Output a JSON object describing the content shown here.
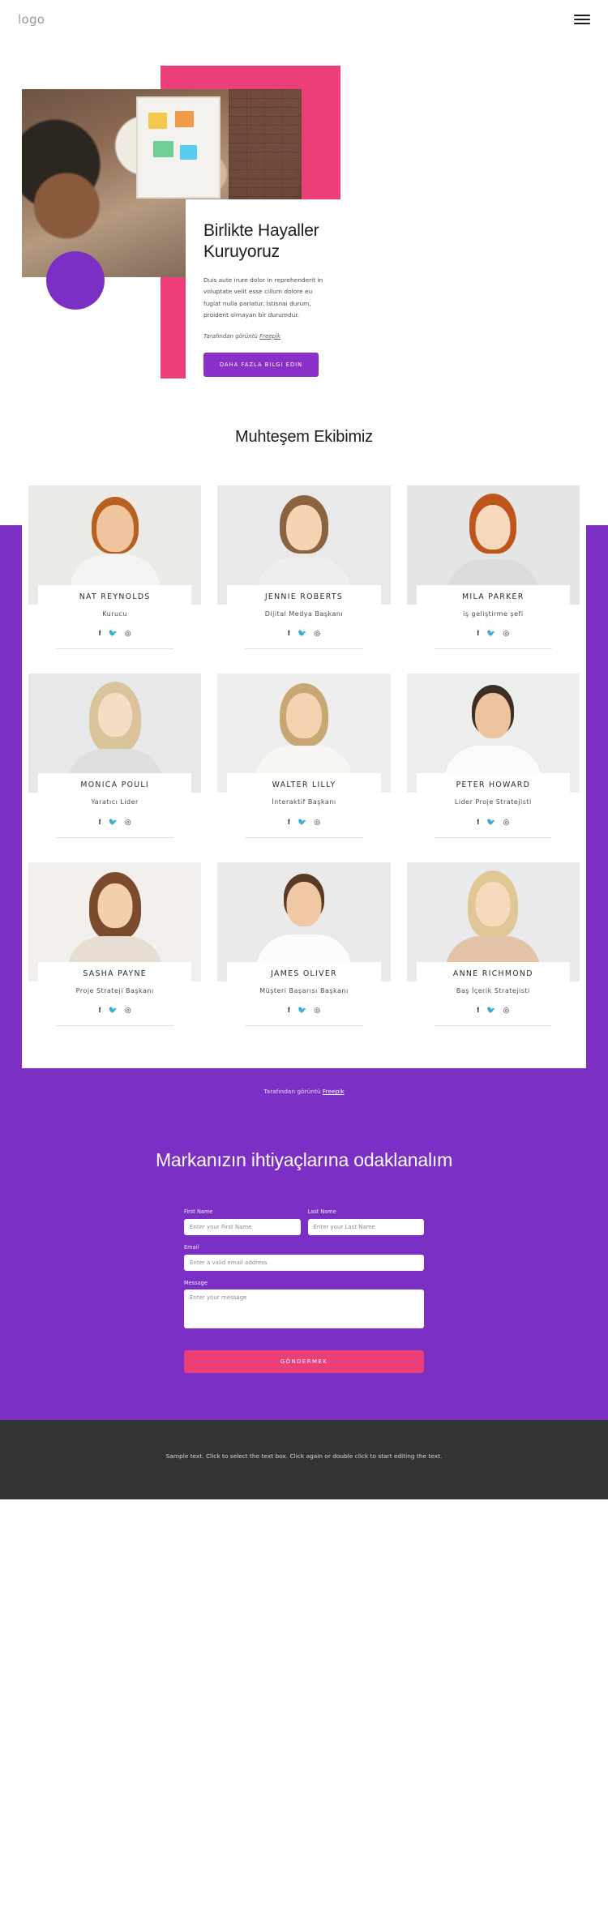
{
  "header": {
    "logo": "logo",
    "menu_icon": "hamburger-menu-icon"
  },
  "hero": {
    "heading": "Birlikte Hayaller Kuruyoruz",
    "body": "Duis aute irure dolor in reprehenderit in voluptate velit esse cillum dolore eu fugiat nulla pariatur. İstisnai durum, proident olmayan bir durumdur.",
    "credit_prefix": "Tarafından görüntü ",
    "credit_link": "Freepik",
    "button": "DAHA FAZLA BILGI EDIN",
    "accent_pink": "#ec3f78",
    "accent_purple": "#7b2fc4"
  },
  "team": {
    "title": "Muhteşem Ekibimiz",
    "credit_prefix": "Tarafından görüntü ",
    "credit_link": "Freepik",
    "social_icons": [
      "facebook-icon",
      "twitter-icon",
      "instagram-icon"
    ],
    "members": [
      {
        "name": "NAT REYNOLDS",
        "role": "Kurucu"
      },
      {
        "name": "JENNIE ROBERTS",
        "role": "Dijital Medya Başkanı"
      },
      {
        "name": "MILA PARKER",
        "role": "iş geliştirme şefi"
      },
      {
        "name": "MONICA POULI",
        "role": "Yaratıcı Lider"
      },
      {
        "name": "WALTER LILLY",
        "role": "İnteraktif Başkanı"
      },
      {
        "name": "PETER HOWARD",
        "role": "Lider Proje Stratejisti"
      },
      {
        "name": "SASHA PAYNE",
        "role": "Proje Strateji Başkanı"
      },
      {
        "name": "JAMES OLIVER",
        "role": "Müşteri Başarısı Başkanı"
      },
      {
        "name": "ANNE RICHMOND",
        "role": "Baş İçerik Stratejisti"
      }
    ]
  },
  "contact": {
    "heading": "Markanızın ihtiyaçlarına odaklanalım",
    "first_name_label": "First Name",
    "first_name_placeholder": "Enter your First Name",
    "first_name_value": "",
    "last_name_label": "Last Name",
    "last_name_placeholder": "Enter your Last Name",
    "last_name_value": "",
    "email_label": "Email",
    "email_placeholder": "Enter a valid email address",
    "email_value": "",
    "message_label": "Message",
    "message_placeholder": "Enter your message",
    "message_value": "",
    "submit_label": "GÖNDERMEK"
  },
  "footer": {
    "text": "Sample text. Click to select the text box. Click again or double click to start editing the text."
  }
}
